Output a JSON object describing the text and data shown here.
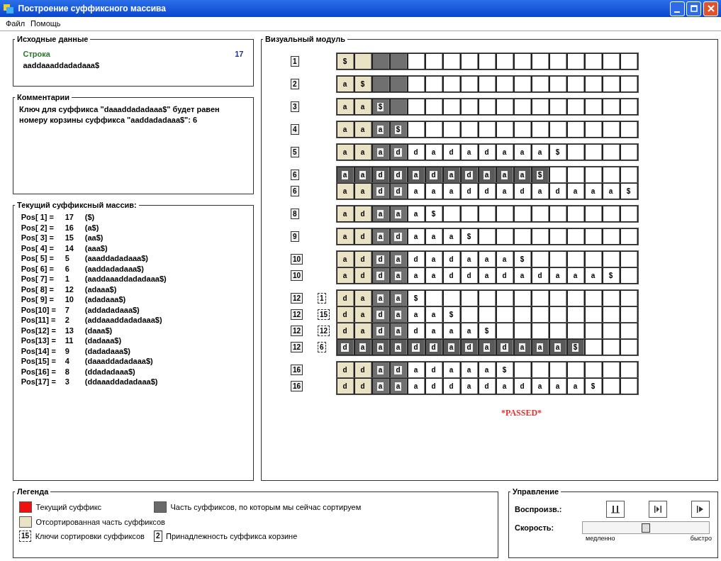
{
  "window": {
    "title": "Построение суффиксного массива"
  },
  "menu": [
    "Файл",
    "Помощь"
  ],
  "source": {
    "title": "Исходные данные",
    "label": "Строка",
    "length": "17",
    "string": "aaddaaaddadadaaa$"
  },
  "comment": {
    "title": "Комментарии",
    "text": "Ключ для суффикса \"daaaddadadaaa$\" будет равен номеру корзины суффикса \"aaddadadaaa$\": 6"
  },
  "suffix_array": {
    "title": "Текущий суффиксный массив:",
    "entries": [
      {
        "pos": "Pos[ 1] =",
        "value": "17",
        "suffix": "($)"
      },
      {
        "pos": "Pos[ 2] =",
        "value": "16",
        "suffix": "(a$)"
      },
      {
        "pos": "Pos[ 3] =",
        "value": "15",
        "suffix": "(aa$)"
      },
      {
        "pos": "Pos[ 4] =",
        "value": "14",
        "suffix": "(aaa$)"
      },
      {
        "pos": "Pos[ 5] =",
        "value": "5",
        "suffix": "(aaaddadadaaa$)"
      },
      {
        "pos": "Pos[ 6] =",
        "value": "6",
        "suffix": "(aaddadadaaa$)"
      },
      {
        "pos": "Pos[ 7] =",
        "value": "1",
        "suffix": "(aaddaaaddadadaaa$)"
      },
      {
        "pos": "Pos[ 8] =",
        "value": "12",
        "suffix": "(adaaa$)"
      },
      {
        "pos": "Pos[ 9] =",
        "value": "10",
        "suffix": "(adadaaa$)"
      },
      {
        "pos": "Pos[10] =",
        "value": "7",
        "suffix": "(addadadaaa$)"
      },
      {
        "pos": "Pos[11] =",
        "value": "2",
        "suffix": "(addaaaddadadaaa$)"
      },
      {
        "pos": "Pos[12] =",
        "value": "13",
        "suffix": "(daaa$)"
      },
      {
        "pos": "Pos[13] =",
        "value": "11",
        "suffix": "(dadaaa$)"
      },
      {
        "pos": "Pos[14] =",
        "value": "9",
        "suffix": "(dadadaaa$)"
      },
      {
        "pos": "Pos[15] =",
        "value": "4",
        "suffix": "(daaaddadadaaa$)"
      },
      {
        "pos": "Pos[16] =",
        "value": "8",
        "suffix": "(ddadadaaa$)"
      },
      {
        "pos": "Pos[17] =",
        "value": "3",
        "suffix": "(ddaaaddadadaaa$)"
      }
    ]
  },
  "visual": {
    "title": "Визуальный модуль",
    "groups": [
      {
        "rows": [
          {
            "key": "1",
            "cells": [
              "$"
            ],
            "current": false
          }
        ]
      },
      {
        "rows": [
          {
            "key": "2",
            "cells": [
              "a",
              "$"
            ],
            "current": false
          }
        ]
      },
      {
        "rows": [
          {
            "key": "3",
            "cells": [
              "a",
              "a",
              "$"
            ],
            "current": false
          }
        ]
      },
      {
        "rows": [
          {
            "key": "4",
            "cells": [
              "a",
              "a",
              "a",
              "$"
            ],
            "current": false
          }
        ]
      },
      {
        "rows": [
          {
            "key": "5",
            "cells": [
              "a",
              "a",
              "a",
              "d",
              "d",
              "a",
              "d",
              "a",
              "d",
              "a",
              "a",
              "a",
              "$"
            ],
            "current": false
          }
        ]
      },
      {
        "rows": [
          {
            "key": "6",
            "cells": [
              "a",
              "a",
              "d",
              "d",
              "a",
              "d",
              "a",
              "d",
              "a",
              "a",
              "a",
              "$"
            ],
            "current": true
          },
          {
            "key": "6",
            "cells": [
              "a",
              "a",
              "d",
              "d",
              "a",
              "a",
              "a",
              "d",
              "d",
              "a",
              "d",
              "a",
              "d",
              "a",
              "a",
              "a",
              "$"
            ],
            "current": false
          }
        ]
      },
      {
        "rows": [
          {
            "key": "8",
            "cells": [
              "a",
              "d",
              "a",
              "a",
              "a",
              "$"
            ],
            "current": false
          }
        ]
      },
      {
        "rows": [
          {
            "key": "9",
            "cells": [
              "a",
              "d",
              "a",
              "d",
              "a",
              "a",
              "a",
              "$"
            ],
            "current": false
          }
        ]
      },
      {
        "rows": [
          {
            "key": "10",
            "cells": [
              "a",
              "d",
              "d",
              "a",
              "d",
              "a",
              "d",
              "a",
              "a",
              "a",
              "$"
            ],
            "current": false
          },
          {
            "key": "10",
            "cells": [
              "a",
              "d",
              "d",
              "a",
              "a",
              "a",
              "d",
              "d",
              "a",
              "d",
              "a",
              "d",
              "a",
              "a",
              "a",
              "$"
            ],
            "current": false
          }
        ]
      },
      {
        "rows": [
          {
            "key": "12",
            "subkey": "1",
            "cells": [
              "d",
              "a",
              "a",
              "a",
              "$"
            ],
            "current": false
          },
          {
            "key": "12",
            "subkey": "15",
            "cells": [
              "d",
              "a",
              "d",
              "a",
              "a",
              "a",
              "$"
            ],
            "current": false
          },
          {
            "key": "12",
            "subkey": "12",
            "cells": [
              "d",
              "a",
              "d",
              "a",
              "d",
              "a",
              "a",
              "a",
              "$"
            ],
            "current": false
          },
          {
            "key": "12",
            "subkey": "6",
            "cells": [
              "d",
              "a",
              "a",
              "a",
              "d",
              "d",
              "a",
              "d",
              "a",
              "d",
              "a",
              "a",
              "a",
              "$"
            ],
            "current": true
          }
        ]
      },
      {
        "rows": [
          {
            "key": "16",
            "cells": [
              "d",
              "d",
              "a",
              "d",
              "a",
              "d",
              "a",
              "a",
              "a",
              "$"
            ],
            "current": false
          },
          {
            "key": "16",
            "cells": [
              "d",
              "d",
              "a",
              "a",
              "a",
              "d",
              "d",
              "a",
              "d",
              "a",
              "d",
              "a",
              "a",
              "a",
              "$"
            ],
            "current": false
          }
        ]
      }
    ],
    "status": "*PASSED*"
  },
  "legend": {
    "title": "Легенда",
    "items": [
      {
        "kind": "current",
        "text": "Текущий суффикс"
      },
      {
        "kind": "sorting",
        "text": "Часть суффиксов, по которым мы сейчас сортируем"
      },
      {
        "kind": "sorted",
        "text": "Отсортированная часть суффиксов"
      },
      {
        "kind": "key",
        "mark": "15",
        "text": "Ключи сортировки суффиксов"
      },
      {
        "kind": "bucket",
        "mark": "2",
        "text": "Принадлежность суффикса корзине"
      }
    ]
  },
  "control": {
    "title": "Управление",
    "play_label": "Воспроизв.:",
    "buttons": [
      {
        "kind": "pause"
      },
      {
        "kind": "step"
      },
      {
        "kind": "play"
      }
    ],
    "speed_label": "Скорость:",
    "speed": {
      "level": 0.5
    },
    "slow": "медленно",
    "fast": "быстро"
  }
}
